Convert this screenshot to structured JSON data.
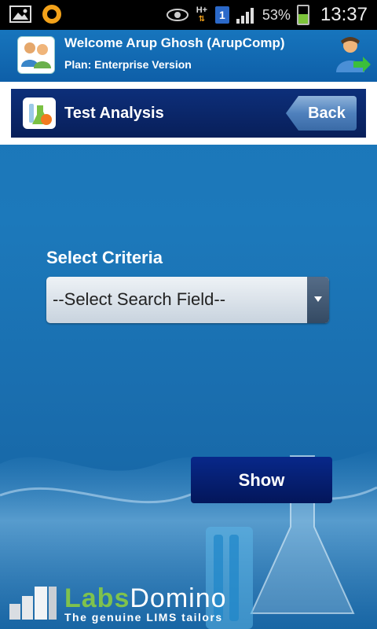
{
  "status_bar": {
    "battery_percent": "53%",
    "sim_slot": "1",
    "network_type": "H+",
    "time": "13:37",
    "icons": [
      "gallery-icon",
      "notification-ring-icon",
      "eye-icon",
      "network-h-plus-icon",
      "sim-icon",
      "signal-icon",
      "battery-icon"
    ]
  },
  "header": {
    "welcome_text": "Welcome Arup Ghosh (ArupComp)",
    "plan_text": "Plan: Enterprise Version"
  },
  "title_bar": {
    "title": "Test Analysis",
    "back_label": "Back"
  },
  "form": {
    "criteria_label": "Select Criteria",
    "select_value": "--Select Search Field--",
    "show_label": "Show"
  },
  "brand": {
    "name_part1": "Labs",
    "name_part2": "Domino",
    "tagline": "The genuine LIMS tailors"
  },
  "colors": {
    "background": "#1a74b6",
    "header": "#1775bd",
    "title_bar": "#0d2f7a",
    "show_button": "#08288a",
    "brand_green": "#7fc24d"
  }
}
